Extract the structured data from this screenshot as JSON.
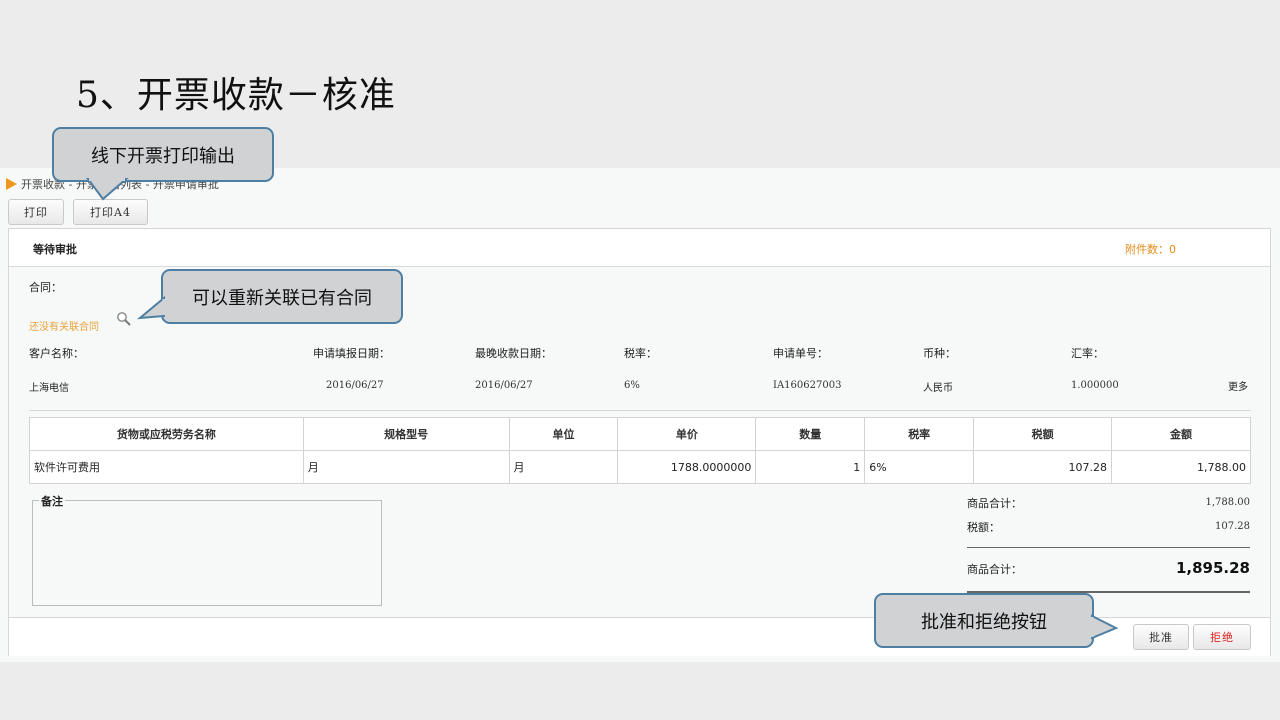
{
  "slide_title": "5、开票收款－核准",
  "breadcrumb": "开票收款 - 开票申请列表 - 开票申请审批",
  "toolbar": {
    "print": "打印",
    "print_a4": "打印A4"
  },
  "status": {
    "text": "等待审批",
    "attachments": "附件数：0"
  },
  "contract": {
    "label": "合同：",
    "link": "还没有关联合同",
    "search_icon": "magnifier-icon"
  },
  "info": {
    "customer_label": "客户名称：",
    "customer": "上海电信",
    "apply_date_label": "申请填报日期：",
    "apply_date": "2016/06/27",
    "latest_date_label": "最晚收款日期：",
    "latest_date": "2016/06/27",
    "tax_rate_label": "税率：",
    "tax_rate": "6%",
    "apply_no_label": "申请单号：",
    "apply_no": "IA160627003",
    "currency_label": "币种：",
    "currency": "人民币",
    "exchange_label": "汇率：",
    "exchange": "1.000000",
    "more": "更多"
  },
  "table": {
    "headers": [
      "货物或应税劳务名称",
      "规格型号",
      "单位",
      "单价",
      "数量",
      "税率",
      "税额",
      "金额"
    ],
    "rows": [
      [
        "软件许可费用",
        "月",
        "月",
        "1788.0000000",
        "1",
        "6%",
        "107.28",
        "1,788.00"
      ]
    ]
  },
  "remarks_label": "备注",
  "summary": {
    "subtotal_label": "商品合计：",
    "subtotal": "1,788.00",
    "tax_label": "税额：",
    "tax": "107.28",
    "total_label": "商品合计：",
    "total": "1,895.28"
  },
  "footer": {
    "approve": "批准",
    "reject": "拒绝"
  },
  "callouts": {
    "print": "线下开票打印输出",
    "relink": "可以重新关联已有合同",
    "buttons": "批准和拒绝按钮"
  },
  "colors": {
    "accent_orange": "#f0961e",
    "callout_border": "#4e7fa3",
    "reject_red": "#dd2222"
  }
}
